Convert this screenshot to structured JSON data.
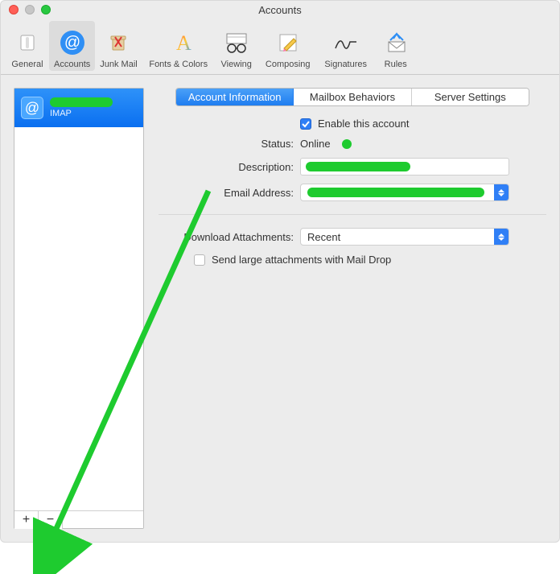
{
  "window": {
    "title": "Accounts"
  },
  "toolbar": {
    "items": [
      {
        "label": "General"
      },
      {
        "label": "Accounts"
      },
      {
        "label": "Junk Mail"
      },
      {
        "label": "Fonts & Colors"
      },
      {
        "label": "Viewing"
      },
      {
        "label": "Composing"
      },
      {
        "label": "Signatures"
      },
      {
        "label": "Rules"
      }
    ],
    "selected_index": 1
  },
  "sidebar": {
    "accounts": [
      {
        "name_redacted": true,
        "type": "IMAP",
        "selected": true
      }
    ],
    "add_label": "+",
    "remove_label": "−"
  },
  "tabs": {
    "items": [
      "Account Information",
      "Mailbox Behaviors",
      "Server Settings"
    ],
    "active_index": 0
  },
  "form": {
    "enable_label": "Enable this account",
    "enable_checked": true,
    "status_label": "Status:",
    "status_value": "Online",
    "description_label": "Description:",
    "email_label": "Email Address:",
    "download_label": "Download Attachments:",
    "download_value": "Recent",
    "maildrop_label": "Send large attachments with Mail Drop",
    "maildrop_checked": false
  },
  "annotation": {
    "arrow_color": "#1ecb2f"
  }
}
